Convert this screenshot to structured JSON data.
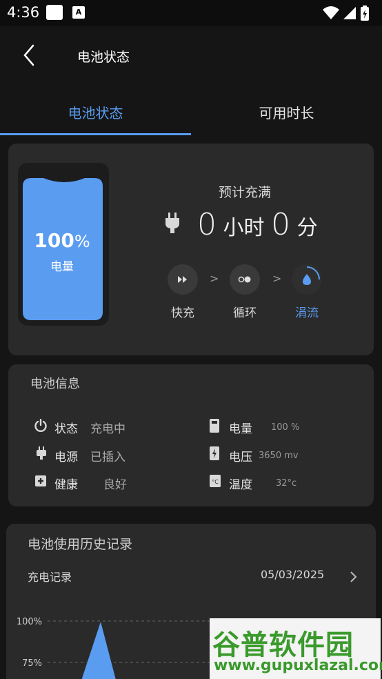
{
  "status_bar": {
    "time": "4:36",
    "badge": "A"
  },
  "header": {
    "title": "电池状态"
  },
  "tabs": [
    {
      "label": "电池状态",
      "active": true
    },
    {
      "label": "可用时长",
      "active": false
    }
  ],
  "battery": {
    "level": "100",
    "unit": "%",
    "label": "电量",
    "fill_fraction": 1.0
  },
  "estimate": {
    "label": "预计充满",
    "hours": "0",
    "hours_unit": "小时",
    "minutes": "0",
    "minutes_unit": "分"
  },
  "stages": [
    {
      "label": "快充",
      "icon": "fast-forward-icon"
    },
    {
      "label": "循环",
      "icon": "cycle-dots-icon"
    },
    {
      "label": "涓流",
      "icon": "droplet-icon",
      "active": true
    }
  ],
  "stage_separator": ">",
  "info": {
    "title": "电池信息",
    "status_label": "状态",
    "status_value": "充电中",
    "power_label": "电源",
    "power_value": "已插入",
    "health_label": "健康",
    "health_value": "良好",
    "level_label": "电量",
    "level_value": "100 %",
    "voltage_label": "电压",
    "voltage_value": "3650 mv",
    "temp_label": "温度",
    "temp_value": "32°c"
  },
  "history": {
    "title": "电池使用历史记录",
    "subtitle": "充电记录",
    "date": "05/03/2025",
    "y_ticks": [
      "100%",
      "75%"
    ]
  },
  "watermark": {
    "name": "谷普软件园",
    "url": "www.gupuxlazal.com"
  },
  "colors": {
    "accent": "#5a9cf0",
    "card": "#2a2a2a",
    "background": "#151515",
    "watermark": "#3a9a2c"
  }
}
